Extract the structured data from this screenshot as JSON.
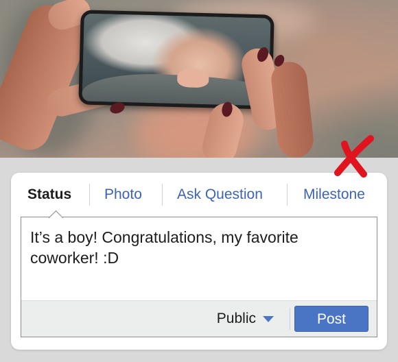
{
  "tabs": [
    {
      "label": "Status",
      "active": true
    },
    {
      "label": "Photo",
      "active": false
    },
    {
      "label": "Ask Question",
      "active": false
    },
    {
      "label": "Milestone",
      "active": false
    }
  ],
  "composer": {
    "text": "It’s a boy! Congratulations, my favorite coworker! :D"
  },
  "footer": {
    "privacy_label": "Public",
    "post_label": "Post"
  },
  "colors": {
    "link_blue": "#3d64b2",
    "post_button": "#4a75c5",
    "cross_red": "#e0141e"
  },
  "icons": {
    "privacy_caret": "caret-down-icon",
    "mark": "red-x-icon"
  }
}
